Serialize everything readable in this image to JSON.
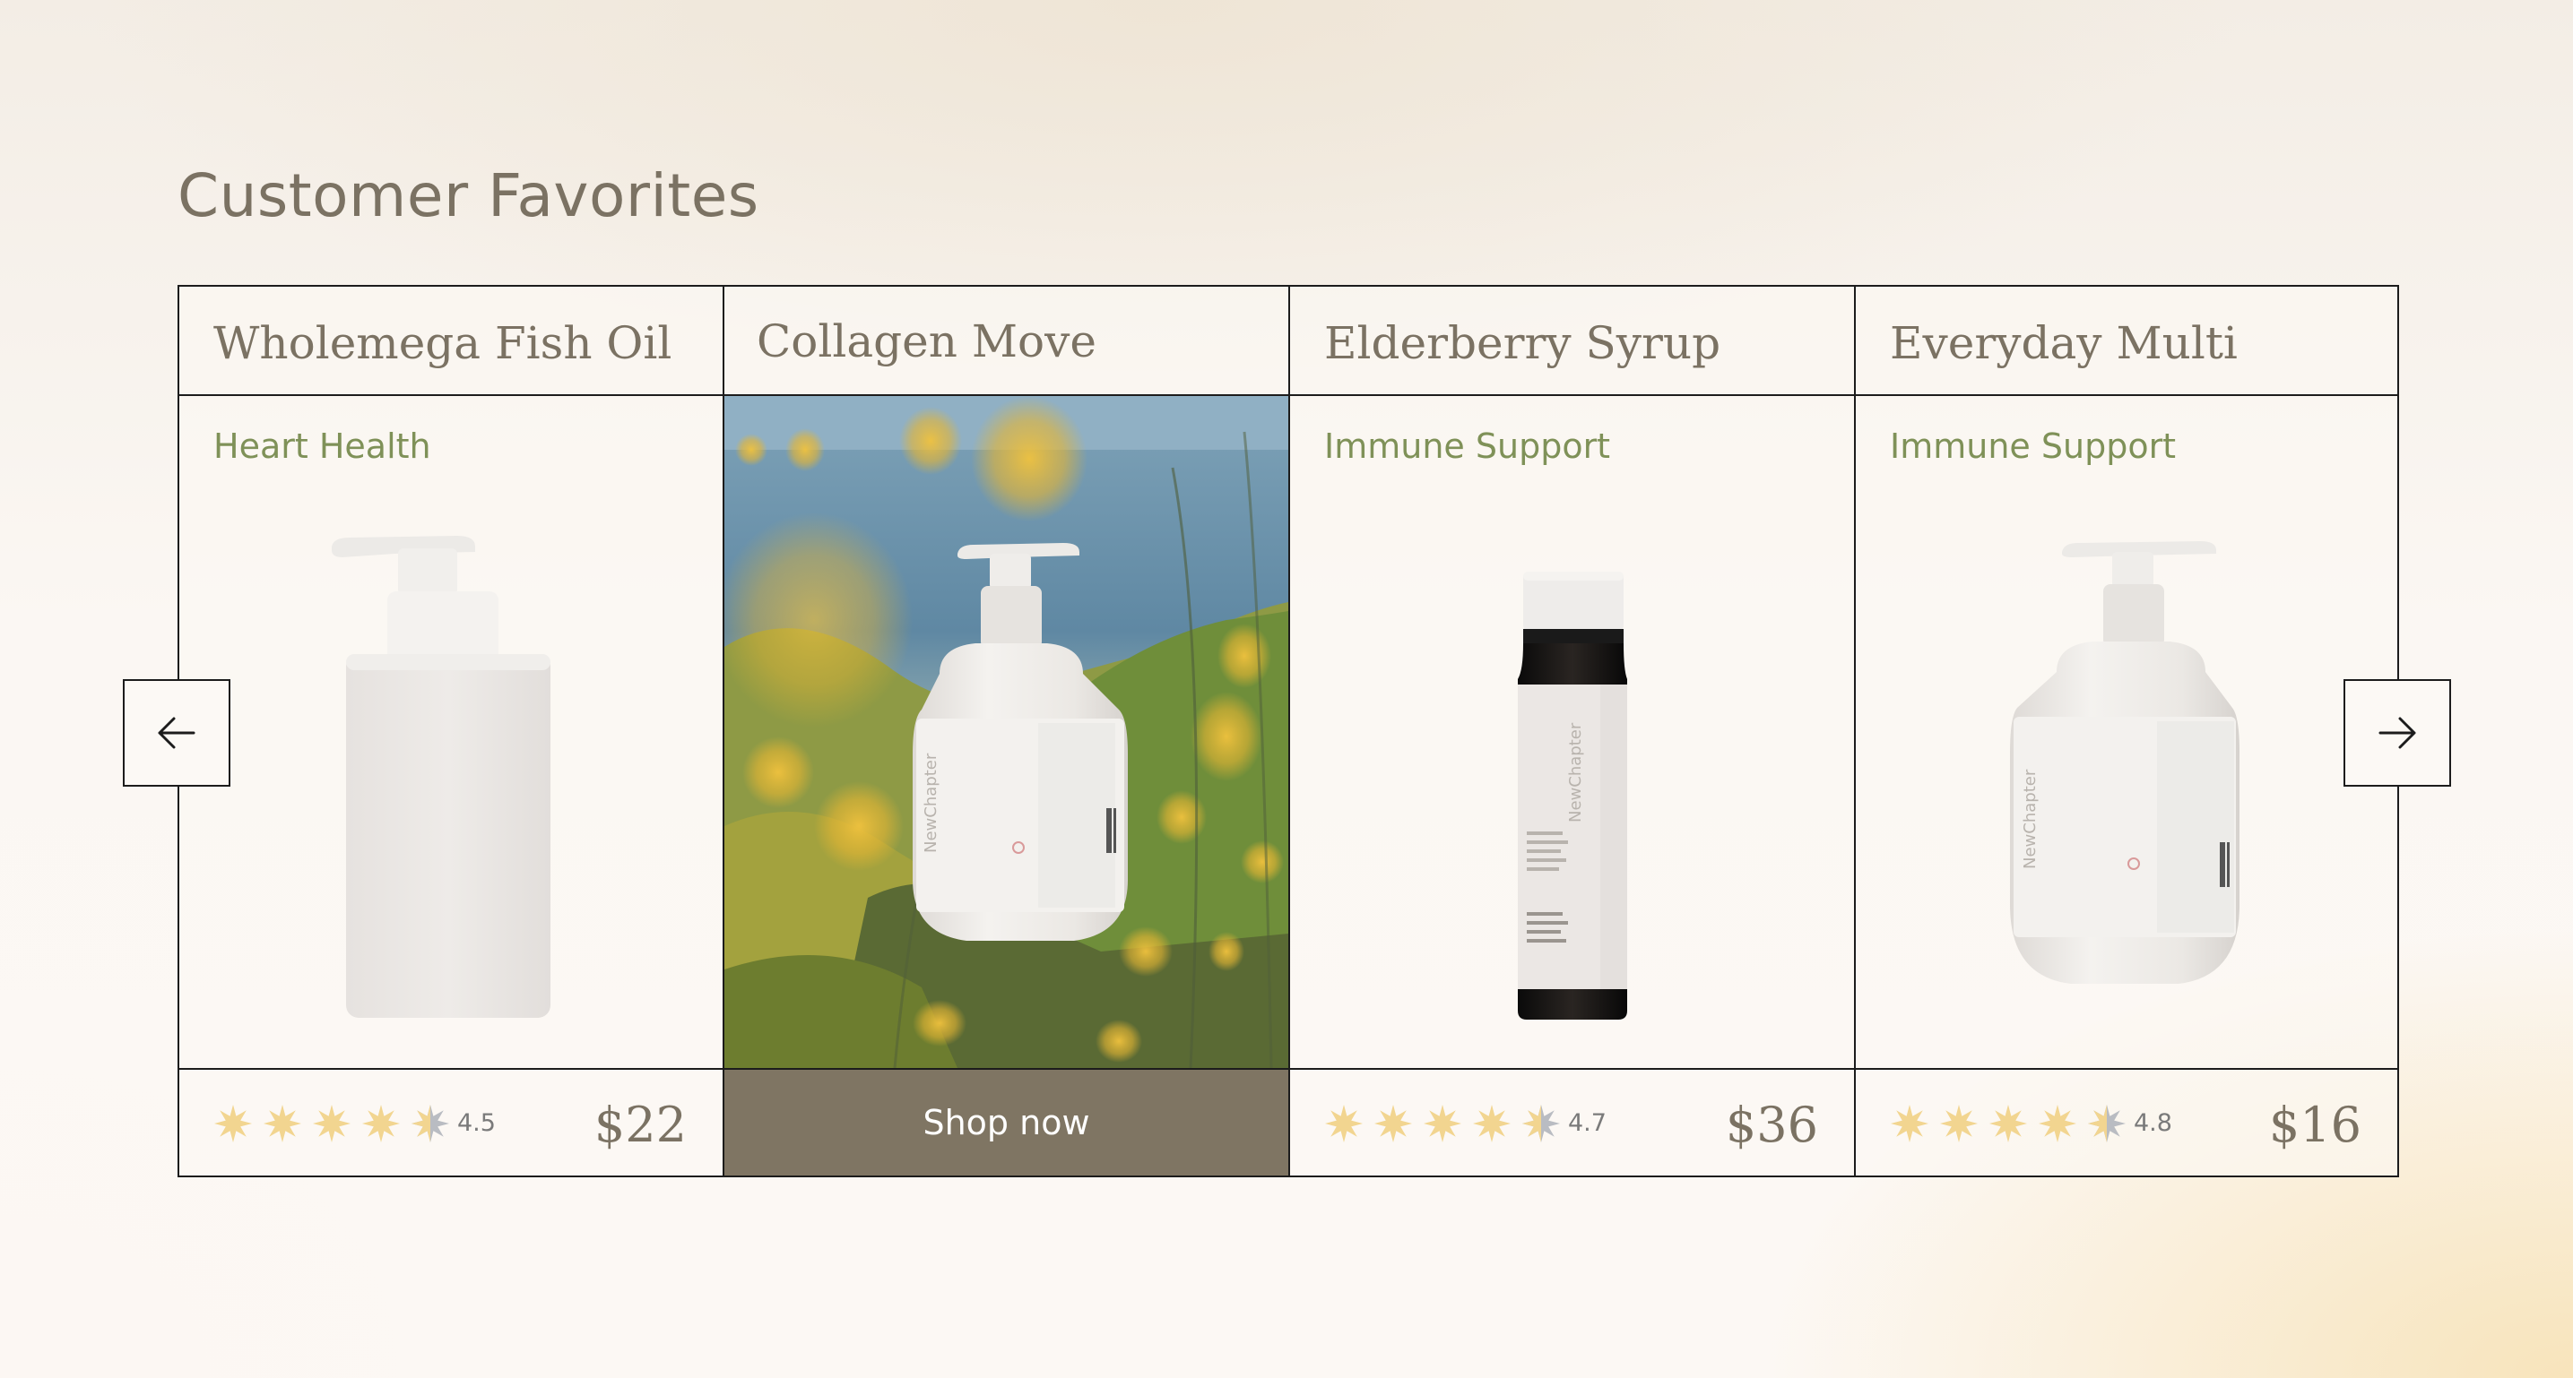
{
  "section": {
    "title": "Customer Favorites"
  },
  "colors": {
    "title": "#7b7263",
    "tag": "#7f9158",
    "button": "#7f7563",
    "star": "#f2d590",
    "star_partial": "#b9bcc2",
    "border": "#1c1c1c"
  },
  "carousel": {
    "prev_icon": "arrow-left-icon",
    "next_icon": "arrow-right-icon",
    "cards": [
      {
        "name": "Wholemega Fish Oil",
        "tag": "Heart Health",
        "rating": "4.5",
        "price": "$22",
        "product_icon": "pump-bottle-square"
      },
      {
        "name": "Collagen Move",
        "cta": "Shop now",
        "product_icon": "pump-bottle-round-featured",
        "bottle_label": "NewChapter"
      },
      {
        "name": "Elderberry Syrup",
        "tag": "Immune Support",
        "rating": "4.7",
        "price": "$36",
        "product_icon": "amber-syrup-bottle",
        "bottle_label": "NewChapter"
      },
      {
        "name": "Everyday Multi",
        "tag": "Immune Support",
        "rating": "4.8",
        "price": "$16",
        "product_icon": "pump-bottle-round",
        "bottle_label": "NewChapter"
      }
    ]
  }
}
